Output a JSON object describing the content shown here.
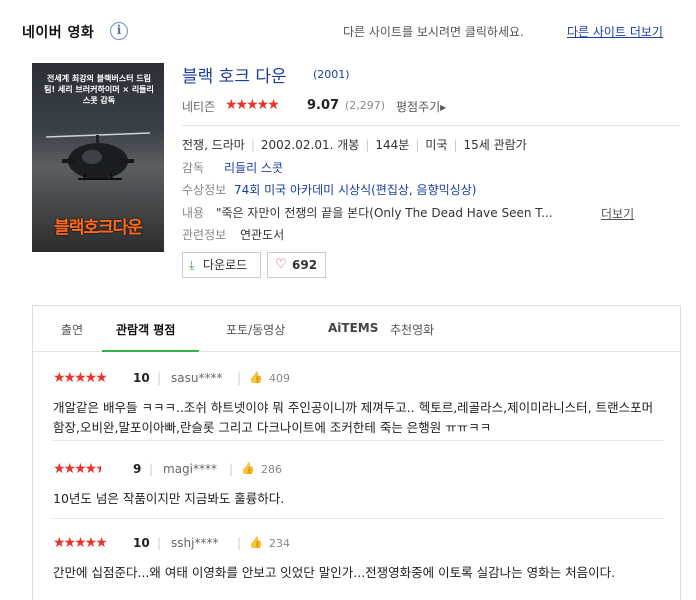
{
  "header": {
    "brand": "네이버 영화",
    "info_glyph": "i",
    "other_site_msg": "다른 사이트를 보시려면 클릭하세요.",
    "other_site_link": "다른 사이트 더보기"
  },
  "poster": {
    "tagline": "전세계 최강의 블랙버스터 드림팀! 세리 브러커하이머 × 리들리 스콧 감독",
    "title": "블랙호크다운"
  },
  "movie": {
    "title": "블랙 호크 다운",
    "year": "(2001)",
    "netizen_label": "네티즌",
    "stars": "★★★★★",
    "score": "9.07",
    "rating_count": "(2,297)",
    "rate_button": "평점주기▸",
    "genre": "전쟁, 드라마",
    "release": "2002.02.01. 개봉",
    "runtime": "144분",
    "country": "미국",
    "age_rating": "15세 관람가",
    "director_label": "감독",
    "director": "리들리 스콧",
    "award_label": "수상정보",
    "award": "74회 미국 아카데미 시상식(편집상, 음향믹싱상)",
    "content_label": "내용",
    "content": "\"죽은 자만이 전쟁의 끝을 본다(Only The Dead Have Seen T...",
    "more_link": "더보기",
    "related_label": "관련정보",
    "related": "연관도서",
    "download_label": "다운로드",
    "likes": "692"
  },
  "tabs": [
    {
      "label": "출연"
    },
    {
      "label": "관람객 평점"
    },
    {
      "label": "포토/동영상"
    },
    {
      "label": "AiTEMS"
    },
    {
      "label": "추천영화"
    }
  ],
  "reviews": [
    {
      "stars": "★★★★★",
      "score": "10",
      "user": "sasu****",
      "likes": "409",
      "text": "개알같은 배우들 ㅋㅋㅋ..조쉬 하트넷이야 뭐 주인공이니까 제껴두고.. 헥토르,레골라스,제이미라니스터, 트랜스포머함장,오비완,말포이아빠,란슬롯 그리고 다크나이트에 조커한테 죽는 은행원 ㅠㅠㅋㅋ"
    },
    {
      "stars": "★★★★★",
      "score": "9",
      "user": "magi****",
      "likes": "286",
      "text": "10년도 넘은 작품이지만 지금봐도 훌륭하다."
    },
    {
      "stars": "★★★★★",
      "score": "10",
      "user": "sshj****",
      "likes": "234",
      "text": "간만에 십점준다...왜 여태 이영화를 안보고 잇었단 말인가...전쟁영화중에 이토록 실감나는 영화는 처음이다."
    }
  ],
  "colors": {
    "accent_blue": "#1a3ea6",
    "star_red": "#e8352b",
    "tab_green": "#37b34a"
  }
}
